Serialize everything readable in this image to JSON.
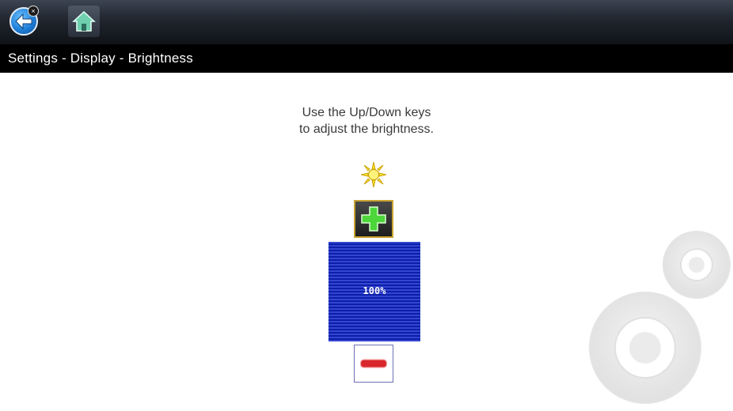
{
  "toolbar": {
    "buttons": [
      {
        "name": "back",
        "icon": "back-arrow-icon"
      },
      {
        "name": "home",
        "icon": "home-icon"
      }
    ]
  },
  "title": "Settings - Display - Brightness",
  "instructions": {
    "line1": "Use the Up/Down keys",
    "line2": "to adjust the brightness."
  },
  "brightness": {
    "level_label": "100%",
    "level_percent": 100,
    "increase_icon": "plus-icon",
    "decrease_icon": "minus-icon",
    "sun_icon": "sun-icon"
  },
  "colors": {
    "toolbar": "#20252e",
    "titlebar": "#000000",
    "level_bar": "#1a2cc0",
    "plus_border": "#c9a431",
    "plus_glyph": "#4cd63a",
    "minus_glyph": "#d8262b"
  },
  "decoration": {
    "background_icon": "gears-icon"
  }
}
